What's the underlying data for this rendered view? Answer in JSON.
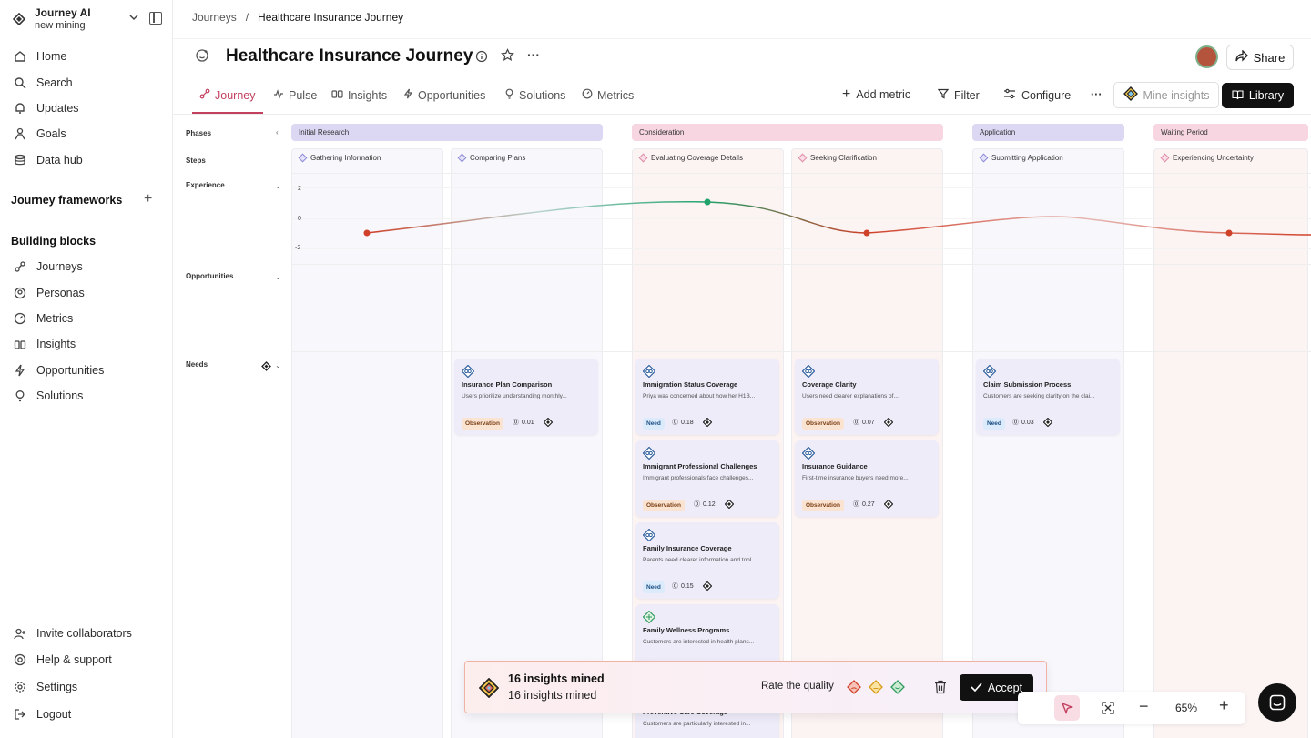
{
  "workspace": {
    "name": "Journey AI",
    "subtitle": "new mining"
  },
  "nav": [
    {
      "label": "Home",
      "icon": "home-icon"
    },
    {
      "label": "Search",
      "icon": "search-icon"
    },
    {
      "label": "Updates",
      "icon": "bell-icon"
    },
    {
      "label": "Goals",
      "icon": "goals-icon"
    },
    {
      "label": "Data hub",
      "icon": "database-icon"
    }
  ],
  "sections": {
    "frameworks": "Journey frameworks",
    "blocks": "Building blocks"
  },
  "blocks": [
    {
      "label": "Journeys",
      "icon": "journeys-icon"
    },
    {
      "label": "Personas",
      "icon": "personas-icon"
    },
    {
      "label": "Metrics",
      "icon": "metrics-icon"
    },
    {
      "label": "Insights",
      "icon": "insights-icon"
    },
    {
      "label": "Opportunities",
      "icon": "opportunities-icon"
    },
    {
      "label": "Solutions",
      "icon": "solutions-icon"
    }
  ],
  "footer_nav": [
    {
      "label": "Invite collaborators",
      "icon": "invite-icon"
    },
    {
      "label": "Help & support",
      "icon": "help-icon"
    },
    {
      "label": "Settings",
      "icon": "settings-icon"
    },
    {
      "label": "Logout",
      "icon": "logout-icon"
    }
  ],
  "breadcrumb": {
    "root": "Journeys",
    "sep": "/",
    "current": "Healthcare Insurance Journey"
  },
  "page_title": "Healthcare Insurance Journey",
  "share_label": "Share",
  "tabs": [
    {
      "label": "Journey",
      "icon": "journey-icon",
      "active": true
    },
    {
      "label": "Pulse",
      "icon": "pulse-icon"
    },
    {
      "label": "Insights",
      "icon": "insights-icon"
    },
    {
      "label": "Opportunities",
      "icon": "bolt-icon"
    },
    {
      "label": "Solutions",
      "icon": "bulb-icon"
    },
    {
      "label": "Metrics",
      "icon": "gauge-icon"
    }
  ],
  "toolbar": {
    "add_metric": "Add metric",
    "filter": "Filter",
    "configure": "Configure",
    "mine": "Mine insights",
    "library": "Library"
  },
  "rows": {
    "phases": "Phases",
    "steps": "Steps",
    "experience": "Experience",
    "opportunities": "Opportunities",
    "needs": "Needs"
  },
  "y_ticks": [
    "2",
    "0",
    "-2"
  ],
  "phases": [
    "Initial Research",
    "Consideration",
    "Application",
    "Waiting Period"
  ],
  "steps": [
    "Gathering Information",
    "Comparing Plans",
    "Evaluating Coverage Details",
    "Seeking Clarification",
    "Submitting Application",
    "Experiencing Uncertainty"
  ],
  "cards": [
    {
      "title": "Insurance Plan Comparison",
      "desc": "Users prioritize understanding monthly...",
      "tag": "Observation",
      "score": "0.01"
    },
    {
      "title": "Immigration Status Coverage",
      "desc": "Priya was concerned about how her H1B...",
      "tag": "Need",
      "score": "0.18"
    },
    {
      "title": "Immigrant Professional Challenges",
      "desc": "Immigrant professionals face challenges...",
      "tag": "Observation",
      "score": "0.12"
    },
    {
      "title": "Family Insurance Coverage",
      "desc": "Parents need clearer information and tool...",
      "tag": "Need",
      "score": "0.15"
    },
    {
      "title": "Family Wellness Programs",
      "desc": "Customers are interested in health plans..."
    },
    {
      "title": "Preventive Care Coverage",
      "desc": "Customers are particularly interested in..."
    },
    {
      "title": "Coverage Clarity",
      "desc": "Users need clearer explanations of...",
      "tag": "Observation",
      "score": "0.07"
    },
    {
      "title": "Insurance Guidance",
      "desc": "First-time insurance buyers need more...",
      "tag": "Observation",
      "score": "0.27"
    },
    {
      "title": "Claim Submission Process",
      "desc": "Customers are seeking clarity on the clai...",
      "tag": "Need",
      "score": "0.03"
    }
  ],
  "banner": {
    "title": "16 insights mined",
    "subtitle": "16 insights mined",
    "rate": "Rate the quality",
    "accept": "Accept"
  },
  "zoom": "65%",
  "colors": {
    "accent": "#c2415f",
    "experience_line": "#d0412a",
    "positive_point": "#1fa36b"
  }
}
